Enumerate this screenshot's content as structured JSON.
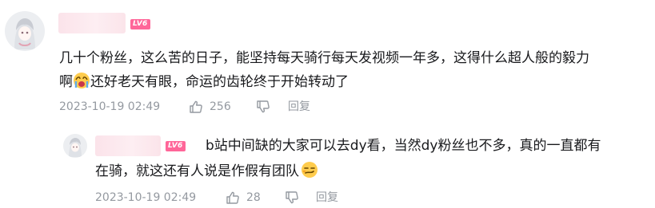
{
  "colors": {
    "level_badge": "#ff6699",
    "meta_text": "#9499a0",
    "body_text": "#18191c"
  },
  "comment": {
    "level": "LV6",
    "text_line1": "几十个粉丝，这么苦的日子，能坚持每天骑行每天发视频一年多，这得什么超人般的毅力",
    "text_line2_prefix": "啊",
    "emoji": "crying-face-emoji",
    "text_line2_suffix": "还好老天有眼，命运的齿轮终于开始转动了",
    "date": "2023-10-19 02:49",
    "likes": "256",
    "reply_label": "回复"
  },
  "reply": {
    "level": "LV6",
    "text_line1": "b站中间缺的大家可以去dy看，当然dy粉丝也不多，真的一直都有",
    "text_line2": "在骑，就这还有人说是作假有团队",
    "emoji": "smirk-face-emoji",
    "date": "2023-10-19 02:49",
    "likes": "28",
    "reply_label": "回复"
  }
}
